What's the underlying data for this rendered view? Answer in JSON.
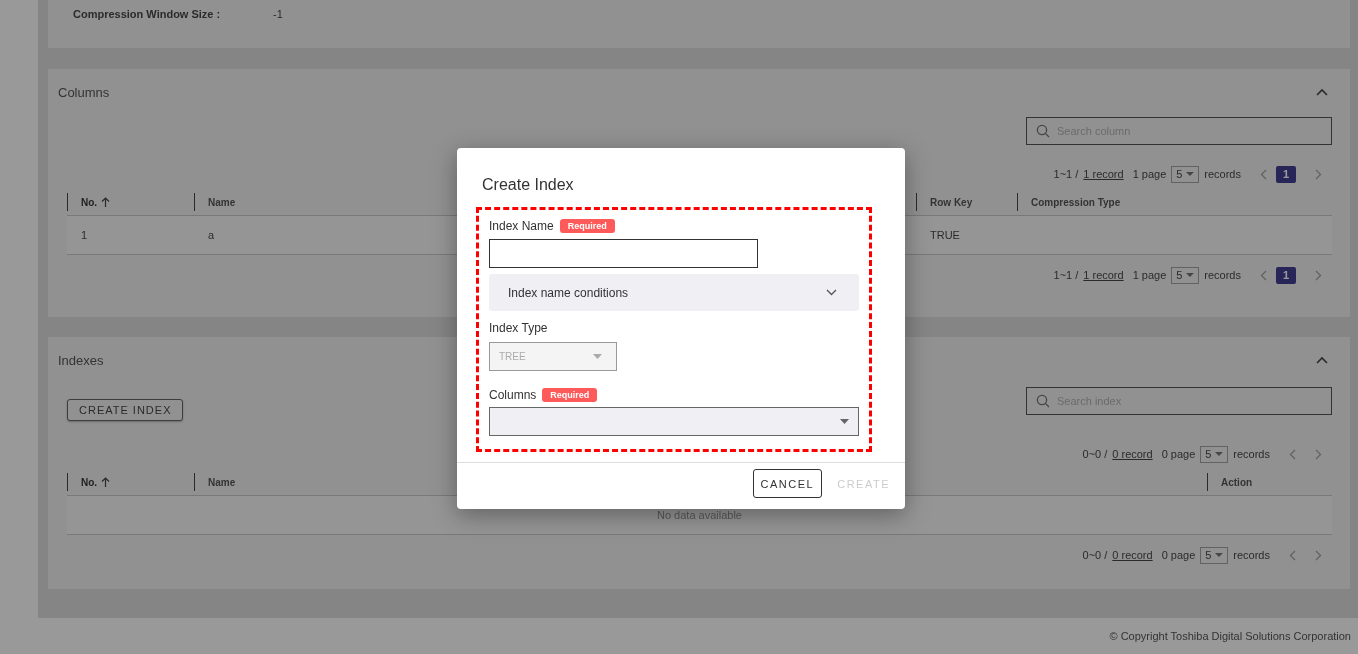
{
  "top_panel": {
    "fields": [
      {
        "label": "Compression Window Size :",
        "value": "-1"
      }
    ]
  },
  "columns_panel": {
    "title": "Columns",
    "expanded": true,
    "search": {
      "placeholder": "Search column"
    },
    "pagination_top": {
      "range": "1~1 /",
      "total": "1 record",
      "pages": "1 page",
      "per_page": "5",
      "unit": "records",
      "page_buttons": [
        {
          "label": "1",
          "selected": true
        }
      ]
    },
    "table": {
      "columns": [
        {
          "label": "No.",
          "sorted_ascending": true
        },
        {
          "label": "Name",
          "sorted_ascending": false
        },
        {
          "label": "Row Key",
          "sorted_ascending": false
        },
        {
          "label": "Compression Type",
          "sorted_ascending": false
        }
      ],
      "rows": [
        [
          "1",
          "a",
          "TRUE"
        ]
      ]
    },
    "pagination_bottom": {
      "range": "1~1 /",
      "total": "1 record",
      "pages": "1 page",
      "per_page": "5",
      "unit": "records",
      "page_buttons": [
        {
          "label": "1",
          "selected": true
        }
      ]
    }
  },
  "indexes_panel": {
    "title": "Indexes",
    "expanded": true,
    "create_button": "CREATE INDEX",
    "search": {
      "placeholder": "Search index"
    },
    "pagination_top": {
      "range": "0~0 /",
      "total": "0 record",
      "pages": "0 page",
      "per_page": "5",
      "unit": "records"
    },
    "table": {
      "columns": [
        {
          "label": "No.",
          "sorted_ascending": true
        },
        {
          "label": "Name",
          "sorted_ascending": false
        },
        {
          "label": "Action",
          "sorted_ascending": false
        }
      ],
      "empty_text": "No data available"
    },
    "pagination_bottom": {
      "range": "0~0 /",
      "total": "0 record",
      "pages": "0 page",
      "per_page": "5",
      "unit": "records"
    }
  },
  "footer": {
    "copyright": "© Copyright Toshiba Digital Solutions Corporation"
  },
  "dialog": {
    "title": "Create Index",
    "fields": [
      {
        "kind": "text",
        "label": "Index Name",
        "badge": "Required"
      },
      {
        "kind": "expansion",
        "label": "Index name conditions",
        "expanded": false
      },
      {
        "kind": "select",
        "label": "Index Type",
        "value": "TREE",
        "disabled": true
      },
      {
        "kind": "multiselect",
        "label": "Columns",
        "badge": "Required",
        "disabled": false
      }
    ],
    "buttons": [
      {
        "label": "CANCEL",
        "disabled": false
      },
      {
        "label": "CREATE",
        "disabled": true
      }
    ]
  }
}
